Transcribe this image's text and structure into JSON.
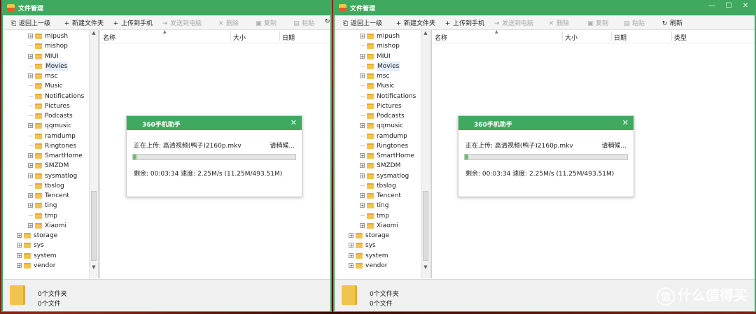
{
  "window": {
    "title": "文件管理",
    "controls": {
      "minimize": "—",
      "maximize": "☐",
      "close": "✕"
    }
  },
  "toolbar": {
    "back": "返回上一级",
    "new_folder": "新建文件夹",
    "upload": "上传到手机",
    "send_pc": "发送到电脑",
    "delete": "删除",
    "copy": "复制",
    "paste": "粘贴",
    "refresh": "刷新"
  },
  "tree": {
    "items": [
      {
        "label": "mipush",
        "expand": "+"
      },
      {
        "label": "mishop",
        "expand": ""
      },
      {
        "label": "MIUI",
        "expand": "+"
      },
      {
        "label": "Movies",
        "expand": "",
        "selected": true
      },
      {
        "label": "msc",
        "expand": "+"
      },
      {
        "label": "Music",
        "expand": ""
      },
      {
        "label": "Notifications",
        "expand": ""
      },
      {
        "label": "Pictures",
        "expand": ""
      },
      {
        "label": "Podcasts",
        "expand": ""
      },
      {
        "label": "qqmusic",
        "expand": "+"
      },
      {
        "label": "ramdump",
        "expand": ""
      },
      {
        "label": "Ringtones",
        "expand": ""
      },
      {
        "label": "SmartHome",
        "expand": "+"
      },
      {
        "label": "SMZDM",
        "expand": "+"
      },
      {
        "label": "sysmatlog",
        "expand": "+"
      },
      {
        "label": "tbslog",
        "expand": ""
      },
      {
        "label": "Tencent",
        "expand": "+"
      },
      {
        "label": "ting",
        "expand": "+"
      },
      {
        "label": "tmp",
        "expand": ""
      },
      {
        "label": "Xiaomi",
        "expand": "+"
      }
    ],
    "root_items": [
      {
        "label": "storage",
        "expand": "+"
      },
      {
        "label": "sys",
        "expand": "+"
      },
      {
        "label": "system",
        "expand": "+"
      },
      {
        "label": "vendor",
        "expand": "+"
      }
    ]
  },
  "columns": {
    "name": "名称",
    "size": "大小",
    "date": "日期",
    "type": "类型"
  },
  "status": {
    "folders": "0个文件夹",
    "files": "0个文件"
  },
  "dialog": {
    "title": "360手机助手",
    "uploading": "正在上传: 高清视频(鸭子)2160p.mkv",
    "wait": "请稍候...",
    "remaining": "剩余: 00:03:34  速度: 2.25M/s (11.25M/493.51M)",
    "progress_fraction": 0.023
  },
  "watermark": {
    "icon": "值",
    "text": "什么值得买"
  },
  "colors": {
    "accent": "#3fa95f",
    "progress": "#6ec25e"
  }
}
